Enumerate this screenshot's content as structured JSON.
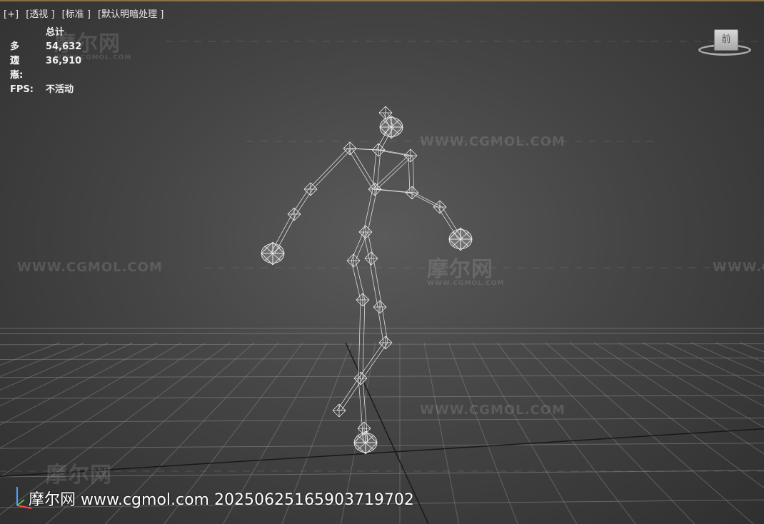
{
  "viewport": {
    "label_parts": [
      "[+]",
      "[透视 ]",
      "[标准 ]",
      "[默认明暗处理 ]"
    ],
    "stats": {
      "header": "总计",
      "rows": [
        {
          "key": "多边形:",
          "value": "54,632"
        },
        {
          "key": "顶点:",
          "value": "36,910"
        }
      ],
      "fps_key": "FPS:",
      "fps_value": "不活动"
    },
    "viewcube_face": "前"
  },
  "watermarks": {
    "url": "WWW.CGMOL.COM",
    "logo": "摩尔网",
    "logo_sub": "WWW.CGMOL.COM",
    "bottom": "摩尔网 www.cgmol.com 20250625165903719702"
  },
  "colors": {
    "background": "#454545",
    "grid": "#8a8a8a",
    "wireframe": "#f2f2f2"
  }
}
